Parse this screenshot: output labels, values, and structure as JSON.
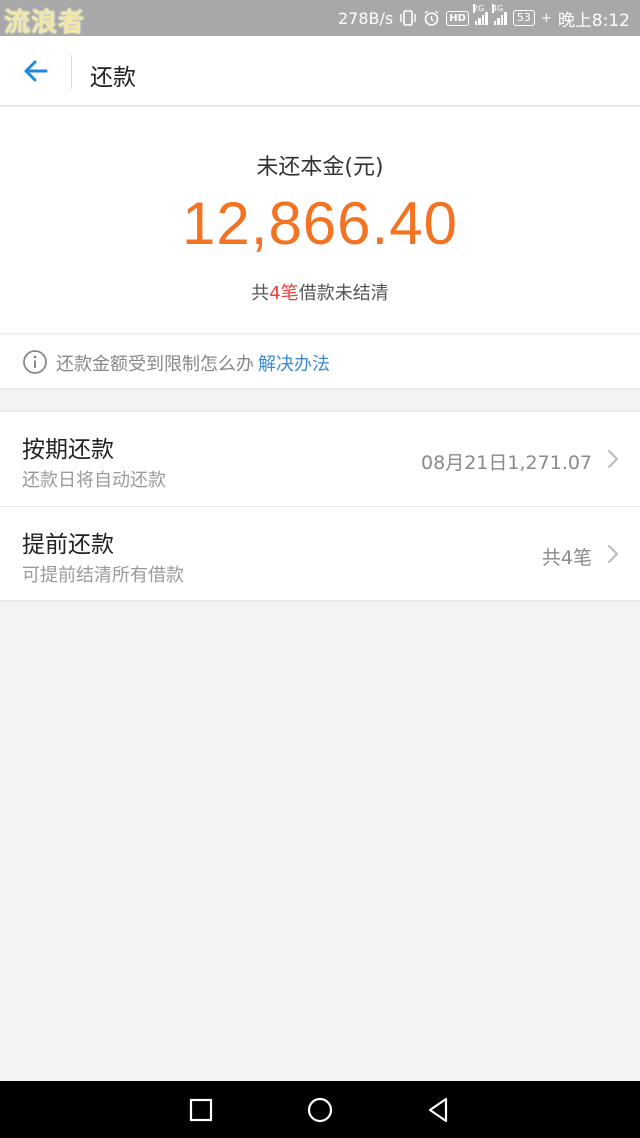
{
  "status_bar": {
    "watermark": "流浪者",
    "net_speed": "278B/s",
    "network_2g": "2G",
    "network_4g": "4G",
    "hd_label": "HD",
    "battery": "53",
    "time": "晚上8:12"
  },
  "header": {
    "title": "还款",
    "back_icon": "arrow-left-icon"
  },
  "summary": {
    "label": "未还本金(元)",
    "amount": "12,866.40",
    "count_prefix": "共",
    "count_highlight": "4笔",
    "count_suffix": "借款未结清",
    "amount_color": "#f47322",
    "highlight_color": "#e9413a"
  },
  "notice": {
    "icon": "info-icon",
    "text": "还款金额受到限制怎么办",
    "link": "解决办法",
    "link_color": "#3b8bd3"
  },
  "list": {
    "items": [
      {
        "title": "按期还款",
        "subtitle": "还款日将自动还款",
        "value": "08月21日1,271.07",
        "icon": "chevron-right-icon"
      },
      {
        "title": "提前还款",
        "subtitle": "可提前结清所有借款",
        "value": "共4笔",
        "icon": "chevron-right-icon"
      }
    ]
  },
  "nav_bar": {
    "recent_icon": "square-icon",
    "home_icon": "circle-icon",
    "back_icon": "triangle-back-icon"
  }
}
